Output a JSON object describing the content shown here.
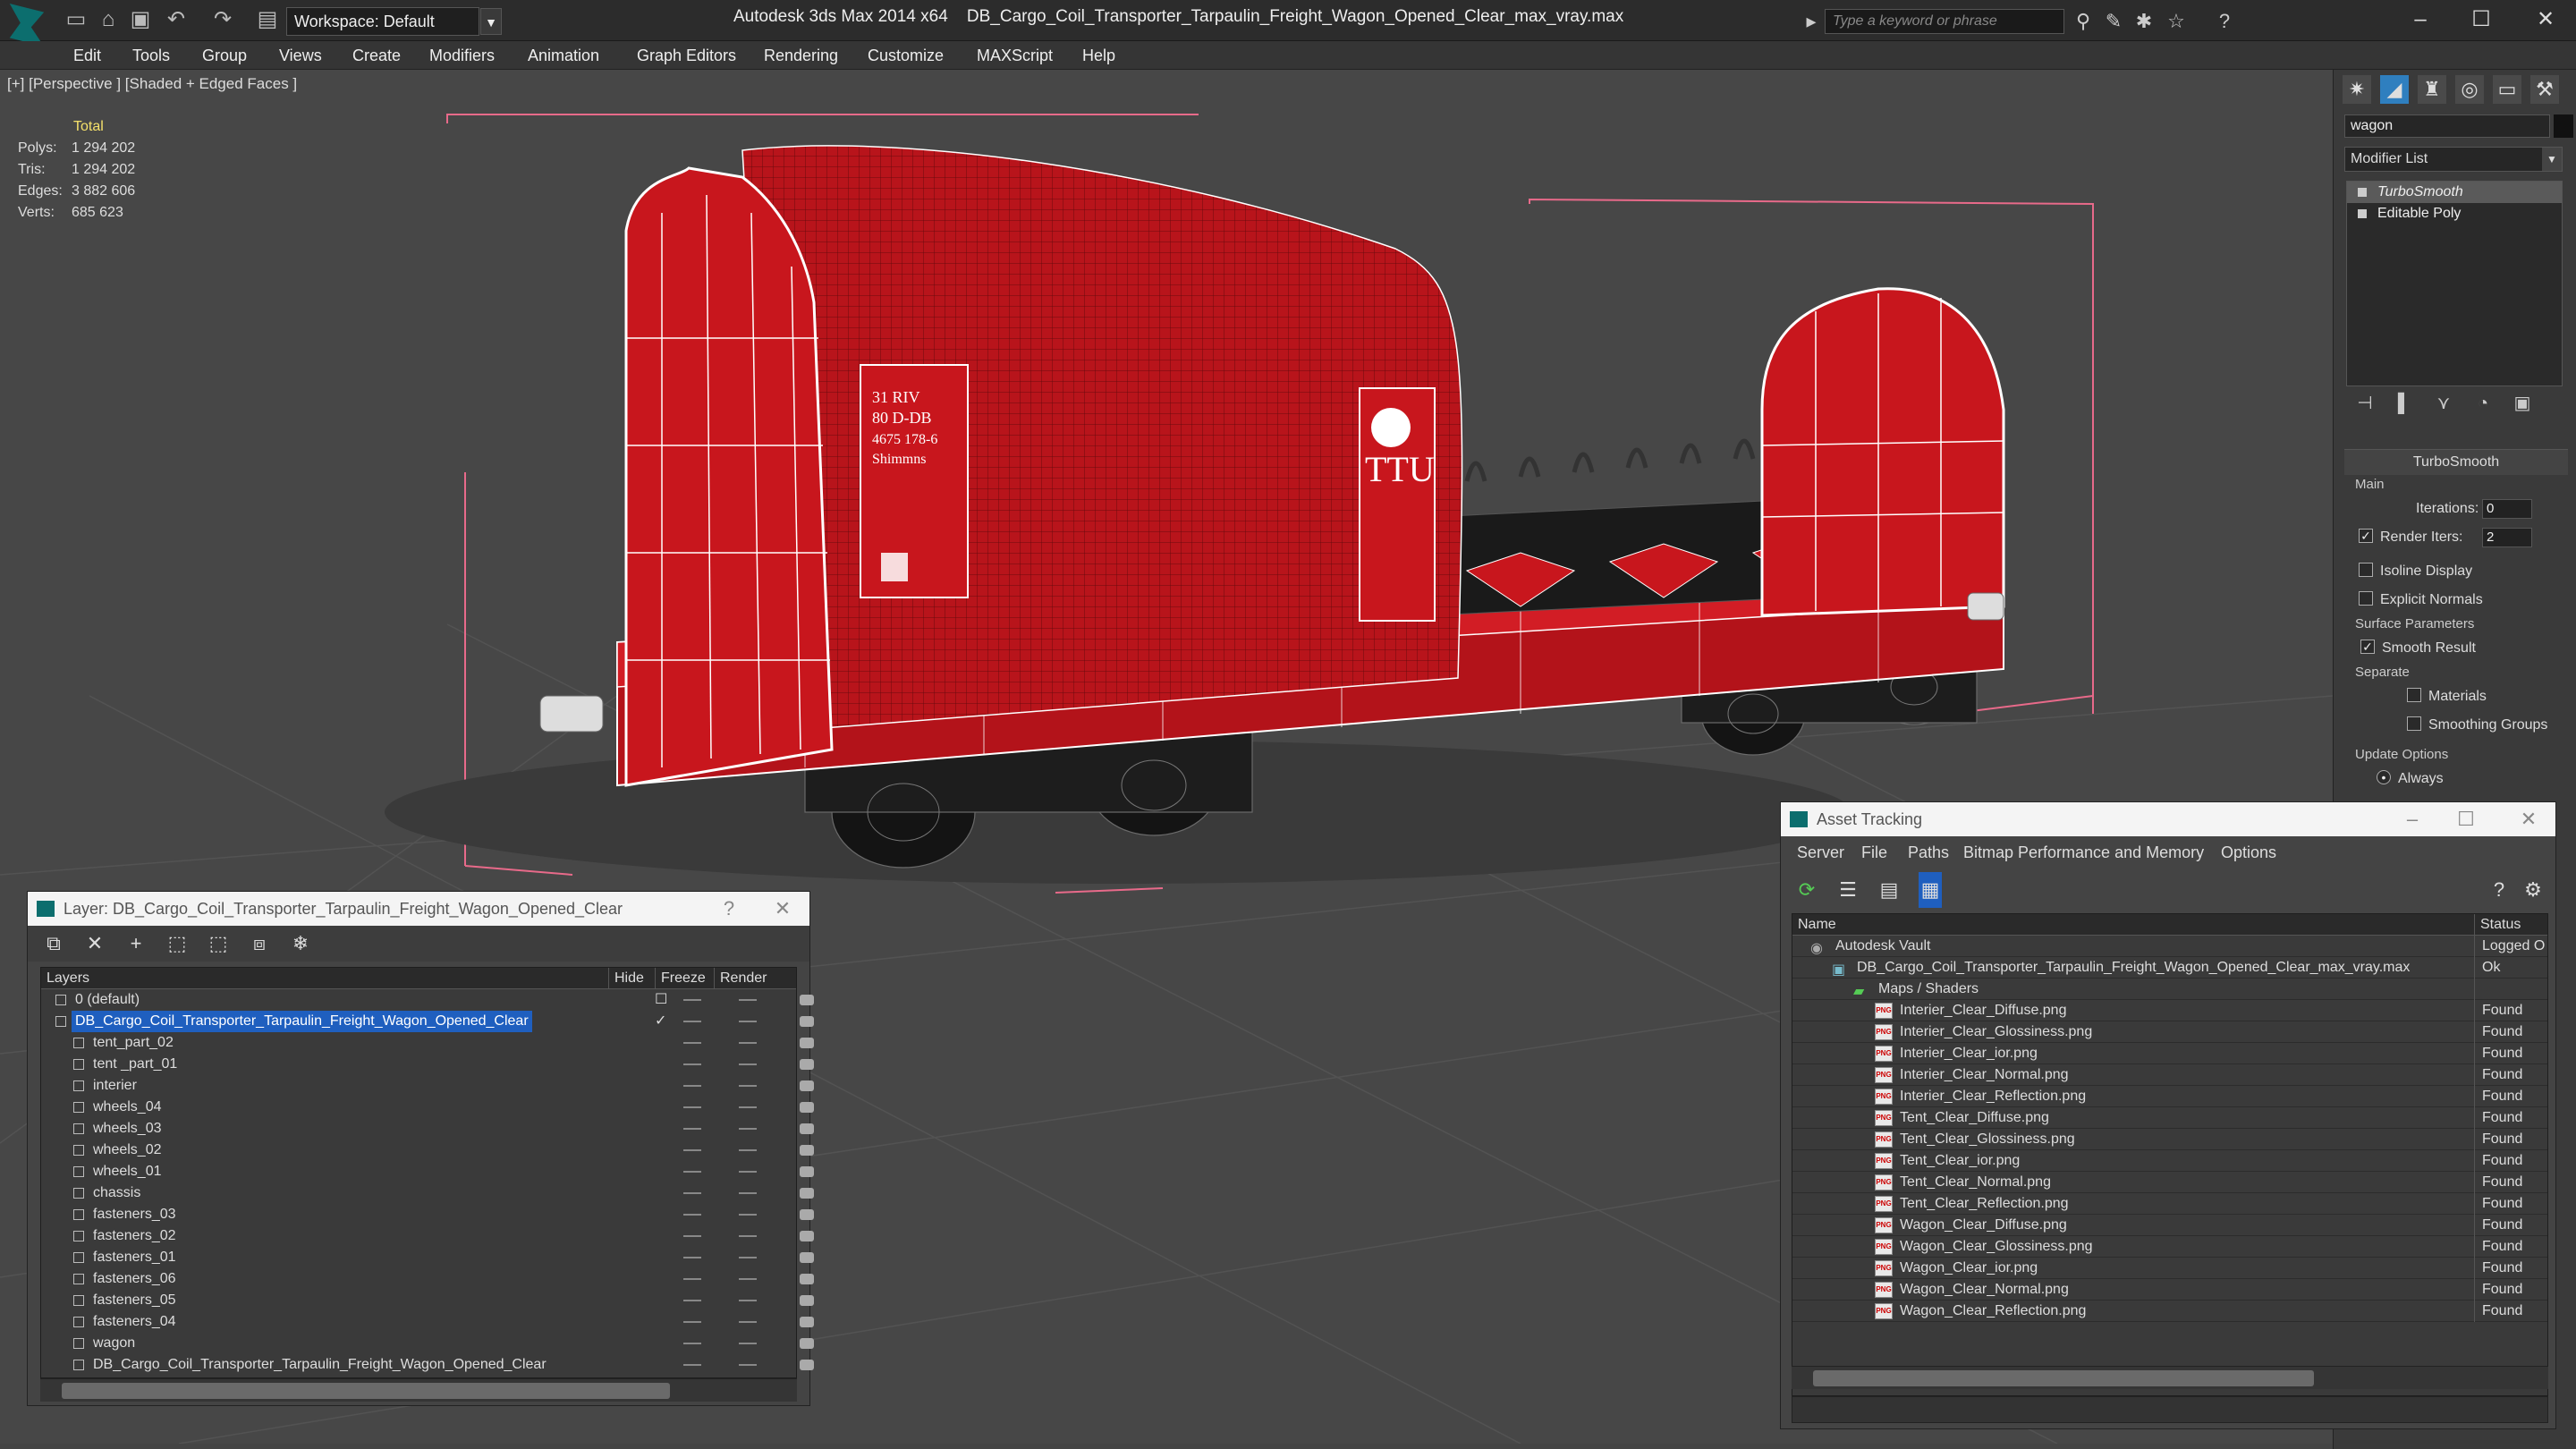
{
  "titlebar": {
    "workspace": "Workspace: Default",
    "app": "Autodesk 3ds Max  2014 x64",
    "file": "DB_Cargo_Coil_Transporter_Tarpaulin_Freight_Wagon_Opened_Clear_max_vray.max",
    "search_placeholder": "Type a keyword or phrase"
  },
  "menu": [
    "Edit",
    "Tools",
    "Group",
    "Views",
    "Create",
    "Modifiers",
    "Animation",
    "Graph Editors",
    "Rendering",
    "Customize",
    "MAXScript",
    "Help"
  ],
  "viewport": {
    "label": "[+] [Perspective ] [Shaded + Edged Faces ]",
    "stats_header": "Total",
    "stats": [
      {
        "k": "Polys:",
        "v": "1 294 202"
      },
      {
        "k": "Tris:",
        "v": "1 294 202"
      },
      {
        "k": "Edges:",
        "v": "3 882 606"
      },
      {
        "k": "Verts:",
        "v": "685 623"
      }
    ],
    "wagon_text": [
      "31 RIV",
      "80 D-DB",
      "4675 178-6",
      "Shimmns",
      "TTU"
    ]
  },
  "command_panel": {
    "object_name": "wagon",
    "modifier_list": "Modifier List",
    "stack": [
      "TurboSmooth",
      "Editable Poly"
    ],
    "rollout": "TurboSmooth",
    "main_group": "Main",
    "iterations_label": "Iterations:",
    "iterations_value": "0",
    "render_iters_label": "Render Iters:",
    "render_iters_value": "2",
    "isoline": "Isoline Display",
    "explicit": "Explicit Normals",
    "surface_group": "Surface Parameters",
    "smooth_result": "Smooth Result",
    "separate": "Separate",
    "materials": "Materials",
    "smoothing_groups": "Smoothing Groups",
    "update_group": "Update Options",
    "always": "Always"
  },
  "layer_window": {
    "title": "Layer: DB_Cargo_Coil_Transporter_Tarpaulin_Freight_Wagon_Opened_Clear",
    "help": "?",
    "columns": [
      "Layers",
      "Hide",
      "Freeze",
      "Render"
    ],
    "rows": [
      {
        "name": "0 (default)",
        "level": 0
      },
      {
        "name": "DB_Cargo_Coil_Transporter_Tarpaulin_Freight_Wagon_Opened_Clear",
        "level": 0,
        "selected": true
      },
      {
        "name": "tent_part_02",
        "level": 1
      },
      {
        "name": "tent _part_01",
        "level": 1
      },
      {
        "name": "interier",
        "level": 1
      },
      {
        "name": "wheels_04",
        "level": 1
      },
      {
        "name": "wheels_03",
        "level": 1
      },
      {
        "name": "wheels_02",
        "level": 1
      },
      {
        "name": "wheels_01",
        "level": 1
      },
      {
        "name": "chassis",
        "level": 1
      },
      {
        "name": "fasteners_03",
        "level": 1
      },
      {
        "name": "fasteners_02",
        "level": 1
      },
      {
        "name": "fasteners_01",
        "level": 1
      },
      {
        "name": "fasteners_06",
        "level": 1
      },
      {
        "name": "fasteners_05",
        "level": 1
      },
      {
        "name": "fasteners_04",
        "level": 1
      },
      {
        "name": "wagon",
        "level": 1
      },
      {
        "name": "DB_Cargo_Coil_Transporter_Tarpaulin_Freight_Wagon_Opened_Clear",
        "level": 1
      }
    ]
  },
  "asset_window": {
    "title": "Asset Tracking",
    "menu": [
      "Server",
      "File",
      "Paths",
      "Bitmap Performance and Memory",
      "Options"
    ],
    "columns": [
      "Name",
      "Status"
    ],
    "rows": [
      {
        "name": "Autodesk Vault",
        "status": "Logged O",
        "level": 0
      },
      {
        "name": "DB_Cargo_Coil_Transporter_Tarpaulin_Freight_Wagon_Opened_Clear_max_vray.max",
        "status": "Ok",
        "level": 1
      },
      {
        "name": "Maps / Shaders",
        "status": "",
        "level": 2
      },
      {
        "name": "Interier_Clear_Diffuse.png",
        "status": "Found",
        "level": 3
      },
      {
        "name": "Interier_Clear_Glossiness.png",
        "status": "Found",
        "level": 3
      },
      {
        "name": "Interier_Clear_ior.png",
        "status": "Found",
        "level": 3
      },
      {
        "name": "Interier_Clear_Normal.png",
        "status": "Found",
        "level": 3
      },
      {
        "name": "Interier_Clear_Reflection.png",
        "status": "Found",
        "level": 3
      },
      {
        "name": "Tent_Clear_Diffuse.png",
        "status": "Found",
        "level": 3
      },
      {
        "name": "Tent_Clear_Glossiness.png",
        "status": "Found",
        "level": 3
      },
      {
        "name": "Tent_Clear_ior.png",
        "status": "Found",
        "level": 3
      },
      {
        "name": "Tent_Clear_Normal.png",
        "status": "Found",
        "level": 3
      },
      {
        "name": "Tent_Clear_Reflection.png",
        "status": "Found",
        "level": 3
      },
      {
        "name": "Wagon_Clear_Diffuse.png",
        "status": "Found",
        "level": 3
      },
      {
        "name": "Wagon_Clear_Glossiness.png",
        "status": "Found",
        "level": 3
      },
      {
        "name": "Wagon_Clear_ior.png",
        "status": "Found",
        "level": 3
      },
      {
        "name": "Wagon_Clear_Normal.png",
        "status": "Found",
        "level": 3
      },
      {
        "name": "Wagon_Clear_Reflection.png",
        "status": "Found",
        "level": 3
      }
    ]
  },
  "colors": {
    "accent": "#1f5fbf",
    "wagon_red": "#c8161d",
    "stats_yellow": "#f5e16b"
  }
}
